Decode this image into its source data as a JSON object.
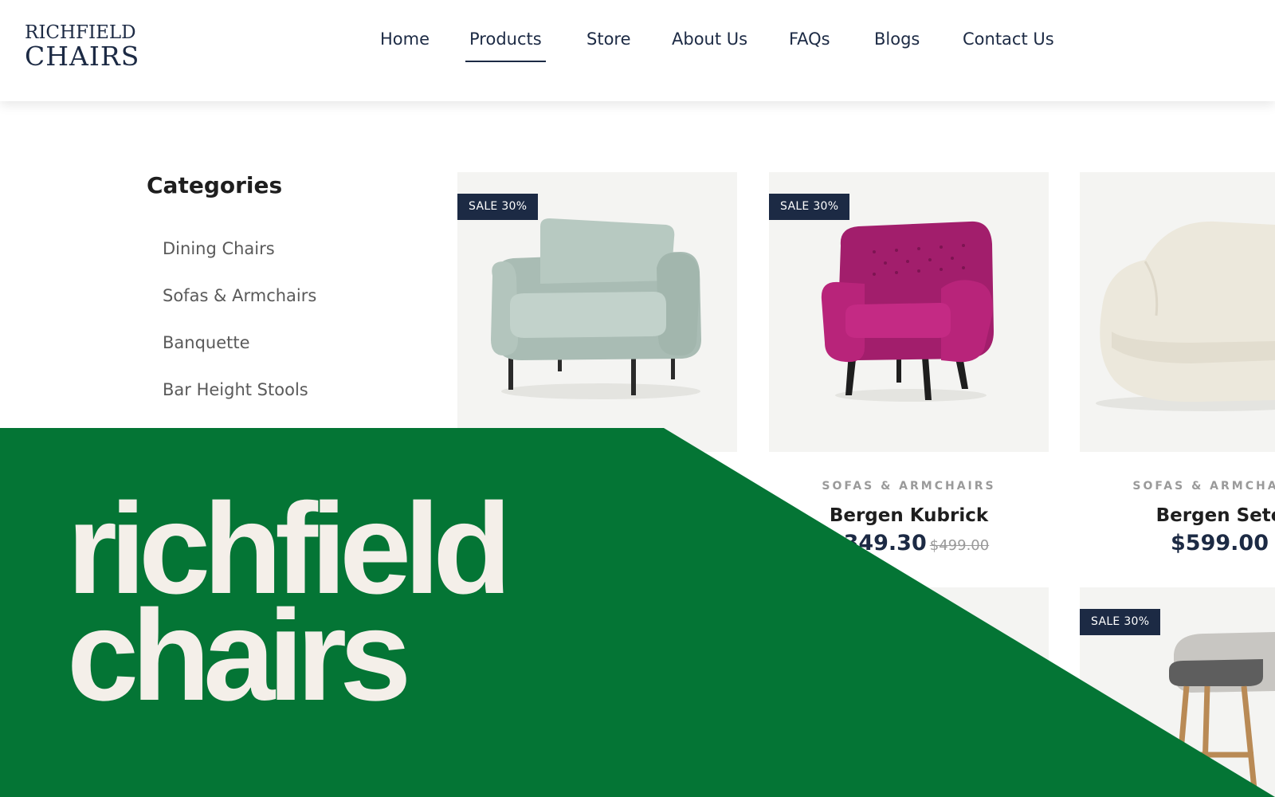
{
  "logo": {
    "line1": "RICHFIELD",
    "line2": "CHAIRS"
  },
  "nav": {
    "items": [
      {
        "label": "Home"
      },
      {
        "label": "Products"
      },
      {
        "label": "Store"
      },
      {
        "label": "About Us"
      },
      {
        "label": "FAQs"
      },
      {
        "label": "Blogs"
      },
      {
        "label": "Contact Us"
      }
    ],
    "active": "Products"
  },
  "sidebar": {
    "title": "Categories",
    "items": [
      {
        "label": "Dining Chairs"
      },
      {
        "label": "Sofas & Armchairs"
      },
      {
        "label": "Banquette"
      },
      {
        "label": "Bar Height Stools"
      }
    ]
  },
  "products": [
    {
      "badge": "SALE 30%",
      "image": "sage-green-armchair"
    },
    {
      "badge": "SALE 30%",
      "category": "SOFAS & ARMCHAIRS",
      "name": "Bergen Kubrick",
      "price": "$349.30",
      "old_price": "$499.00",
      "image": "magenta-wingback-chair"
    },
    {
      "category": "SOFAS & ARMCHAIRS",
      "name": "Bergen Sete",
      "price": "$599.00",
      "image": "cream-boucle-chair"
    },
    {
      "badge": "SALE 30%",
      "image": "wooden-bar-stool"
    }
  ],
  "overlay": {
    "line1": "richfield",
    "line2": "chairs",
    "color": "#047535",
    "text_color": "#f4efe9"
  },
  "colors": {
    "navy": "#1c2a44",
    "card_bg": "#f4f4f2"
  }
}
